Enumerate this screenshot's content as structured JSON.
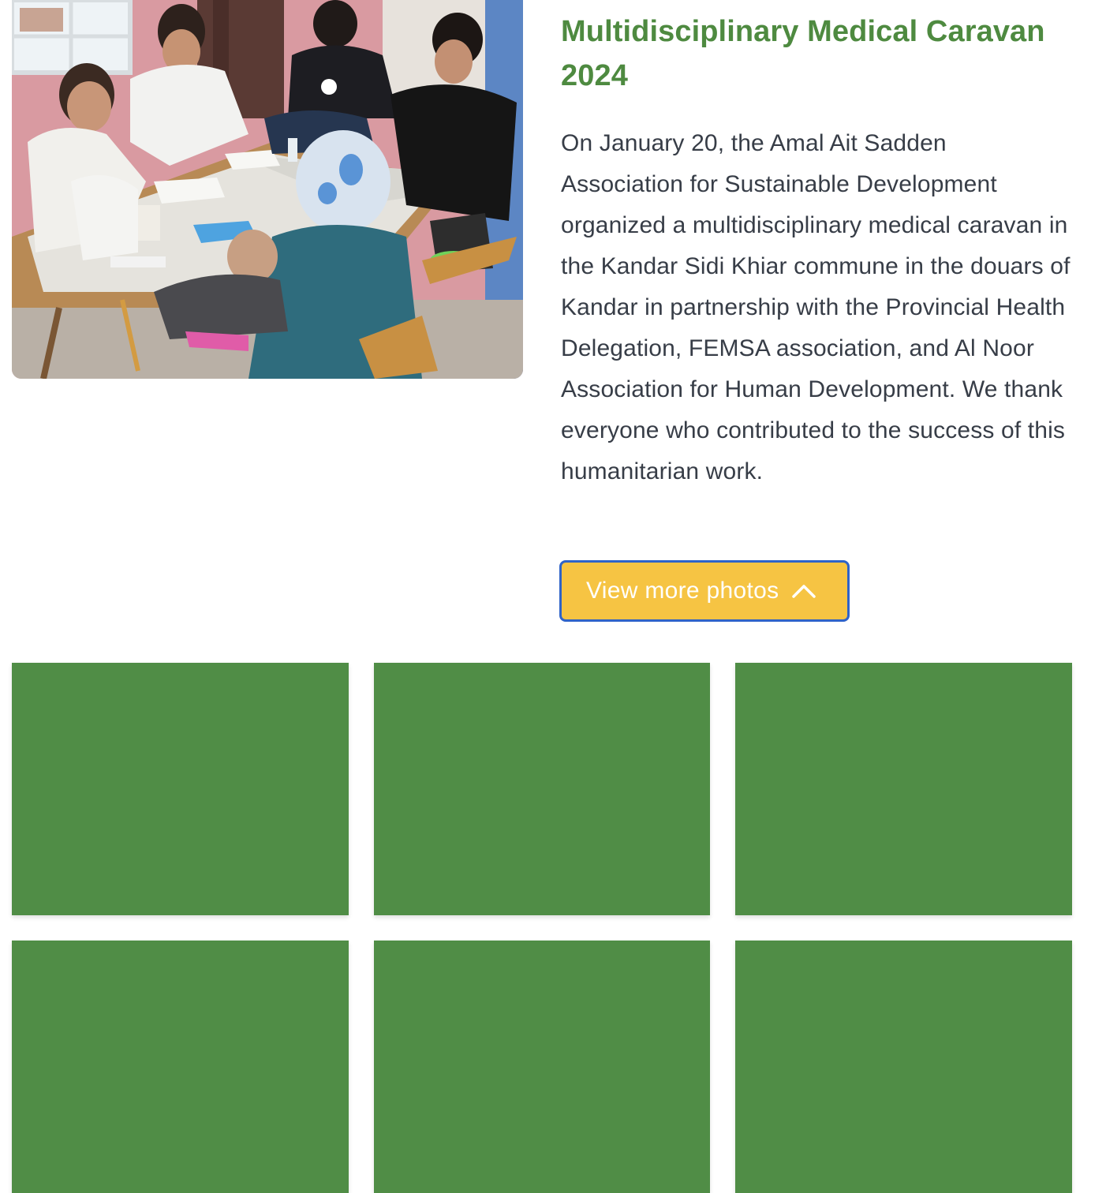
{
  "article": {
    "photo_alt": "Medical caravan consultation photo",
    "title": "Multidisciplinary Medical Caravan 2024",
    "body": "On January 20, the Amal Ait Sadden Association for Sustainable Development organized a multidisciplinary medical caravan in the Kandar Sidi Khiar commune in the douars of Kandar in partnership with the Provincial Health Delegation, FEMSA association, and Al Noor Association for Human Development. We thank everyone who contributed to the success of this humanitarian work.",
    "more_button_label": "View more photos",
    "more_button_icon": "chevron-up-icon"
  },
  "gallery": {
    "tile_color": "#508d46",
    "tiles": [
      "",
      "",
      "",
      "",
      "",
      ""
    ]
  },
  "colors": {
    "title": "#4e8a40",
    "body_text": "#373d47",
    "button_bg": "#f6c443",
    "button_border": "#2f63c8",
    "tile": "#508d46"
  }
}
